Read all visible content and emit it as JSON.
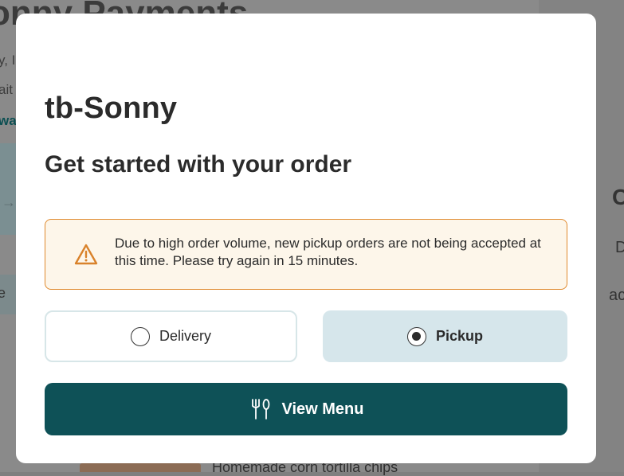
{
  "background": {
    "page_title": "onny Payments",
    "lines": [
      "y, I",
      "ait",
      "wa"
    ],
    "side_text": "se",
    "right_texts": [
      "C",
      "D",
      "ac"
    ],
    "footer_item_text": "Homemade corn tortilla chips"
  },
  "modal": {
    "restaurant_name": "tb-Sonny",
    "subtitle": "Get started with your order",
    "alert": {
      "icon": "warning-triangle-icon",
      "message": "Due to high order volume, new pickup orders are not being accepted at this time. Please try again in 15 minutes."
    },
    "options": {
      "delivery_label": "Delivery",
      "pickup_label": "Pickup",
      "selected": "Pickup"
    },
    "view_menu_label": "View Menu",
    "view_menu_icon": "fork-knife-icon"
  },
  "colors": {
    "accent": "#0e5157",
    "alert_border": "#e08a2e",
    "alert_bg": "#fdf6ea",
    "selected_option_bg": "#d6e6eb"
  }
}
